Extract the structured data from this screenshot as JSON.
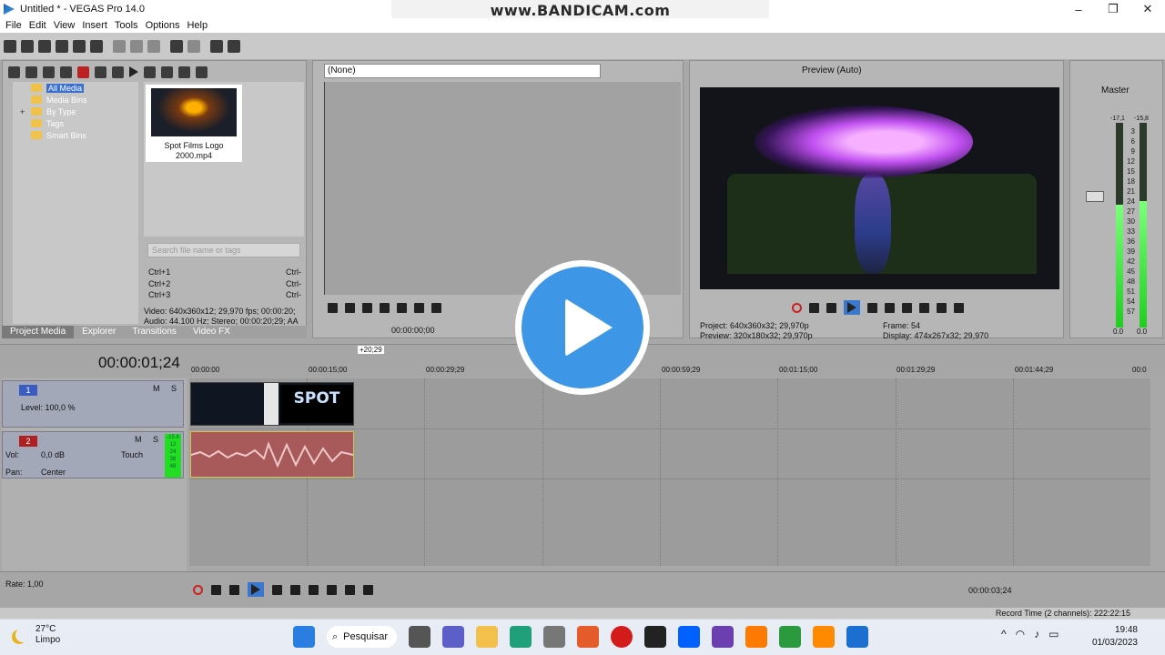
{
  "window": {
    "title": "Untitled * - VEGAS Pro 14.0",
    "watermark": "www.BANDICAM.com",
    "controls": [
      "–",
      "❐",
      "✕"
    ]
  },
  "menu": [
    "File",
    "Edit",
    "View",
    "Insert",
    "Tools",
    "Options",
    "Help"
  ],
  "project_media": {
    "tree": [
      {
        "label": "All Media",
        "selected": true
      },
      {
        "label": "Media Bins"
      },
      {
        "label": "By Type",
        "expandable": true,
        "expander": "+"
      },
      {
        "label": "Tags"
      },
      {
        "label": "Smart Bins"
      }
    ],
    "clip": {
      "name": "Spot Films Logo 2000.mp4"
    },
    "search_placeholder": "Search file name or tags",
    "shortcuts": [
      {
        "key": "Ctrl+1",
        "value": "Ctrl-"
      },
      {
        "key": "Ctrl+2",
        "value": "Ctrl-"
      },
      {
        "key": "Ctrl+3",
        "value": "Ctrl-"
      }
    ],
    "video_info": "Video: 640x360x12; 29,970 fps; 00:00:20;",
    "audio_info": "Audio: 44.100 Hz; Stereo; 00:00:20;29; AA",
    "tabs": [
      "Project Media",
      "Explorer",
      "Transitions",
      "Video FX"
    ]
  },
  "trimmer": {
    "source": "(None)",
    "time": "00:00:00;00"
  },
  "preview": {
    "mode": "Preview (Auto)",
    "project_label": "Project:",
    "project_value": "640x360x32; 29,970p",
    "preview_label": "Preview:",
    "preview_value": "320x180x32; 29,970p",
    "frame_label": "Frame:",
    "frame_value": "54",
    "display_label": "Display:",
    "display_value": "474x267x32; 29,970"
  },
  "mixer": {
    "title": "Master",
    "peak_left": "-17,1",
    "peak_right": "-15,8",
    "scale": [
      "3",
      "6",
      "9",
      "12",
      "15",
      "18",
      "21",
      "24",
      "27",
      "30",
      "33",
      "36",
      "39",
      "42",
      "45",
      "48",
      "51",
      "54",
      "57"
    ],
    "readout_left": "0.0",
    "readout_right": "0.0",
    "level_left": 0.6,
    "level_right": 0.62,
    "meter_color": "#22cc22"
  },
  "timeline": {
    "current_time": "00:00:01;24",
    "clip_marker": "+20;29",
    "ruler": [
      "00:00:00",
      "00:00:15;00",
      "00:00:29;29",
      "00:00:59;29",
      "00:01:15;00",
      "00:01:29;29",
      "00:01:44;29",
      "00:0"
    ],
    "video_track": {
      "number": "1",
      "level": "Level: 100,0 %",
      "solo": "S",
      "mute": "M"
    },
    "audio_track": {
      "number": "2",
      "vol_label": "Vol:",
      "vol_value": "0,0 dB",
      "pan_label": "Pan:",
      "pan_value": "Center",
      "mode": "Touch",
      "meter_top": "-15.8",
      "meter_vals": [
        "12",
        "24",
        "36",
        "48"
      ],
      "solo": "S",
      "mute": "M"
    },
    "video_clip_text": "SPOT",
    "video_clip_color": "#0f1622",
    "audio_clip_color": "#a85a5a"
  },
  "transport": {
    "rate": "Rate: 1,00",
    "time": "00:00:03;24",
    "record_time": "Record Time (2 channels): 222:22:15"
  },
  "taskbar": {
    "temp": "27°C",
    "condition": "Limpo",
    "search": "Pesquisar",
    "time": "19:48",
    "date": "01/03/2023",
    "tray": [
      "^",
      "wifi-icon",
      "speaker-icon",
      "battery-icon"
    ]
  },
  "overlay": {
    "icon": "play-icon",
    "color": "#3d97e6"
  }
}
